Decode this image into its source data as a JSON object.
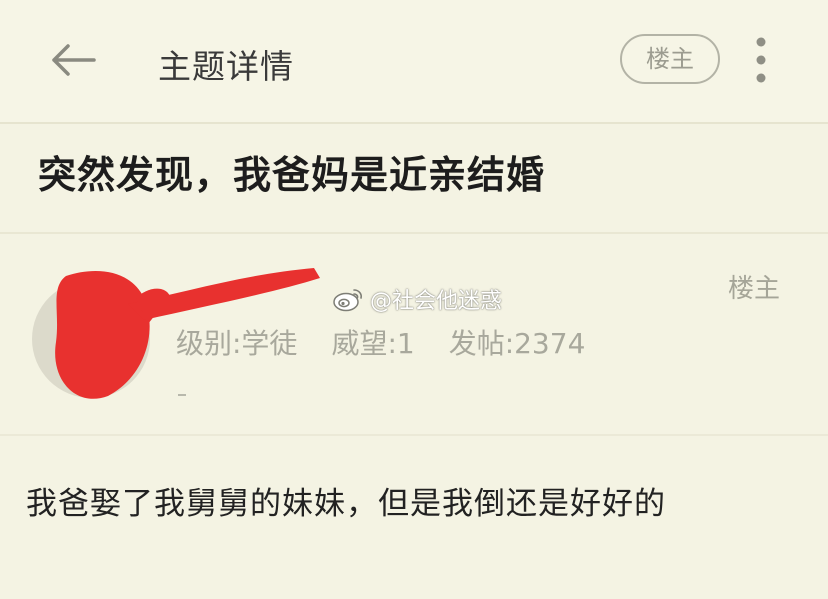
{
  "header": {
    "title": "主题详情",
    "op_badge": "楼主",
    "back_icon": "back-arrow-icon",
    "more_icon": "more-vertical-icon"
  },
  "thread": {
    "title": "突然发现，我爸妈是近亲结婚"
  },
  "post": {
    "floor_label": "楼主",
    "author": {
      "level": "级别:学徒",
      "prestige": "威望:1",
      "posts": "发帖:2374"
    },
    "body": "我爸娶了我舅舅的妹妹，但是我倒还是好好的"
  },
  "watermark": {
    "icon": "weibo-icon",
    "text": "@社会他迷惑"
  },
  "colors": {
    "background": "#f4f3e3",
    "redaction": "#e8312f",
    "secondary_text": "#a8a89c"
  }
}
